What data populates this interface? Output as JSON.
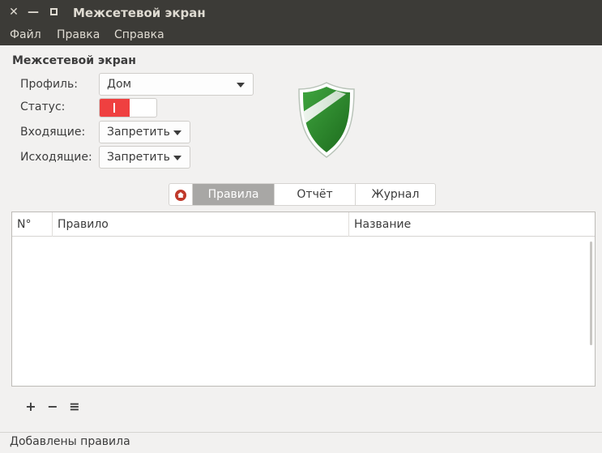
{
  "window": {
    "title": "Межсетевой экран",
    "close_glyph": "✕",
    "minimize_glyph": "—"
  },
  "menu": {
    "file": "Файл",
    "edit": "Правка",
    "help": "Справка"
  },
  "section": {
    "title": "Межсетевой экран"
  },
  "form": {
    "profile_label": "Профиль:",
    "profile_value": "Дом",
    "status_label": "Статус:",
    "status_on": true,
    "incoming_label": "Входящие:",
    "incoming_value": "Запретить",
    "outgoing_label": "Исходящие:",
    "outgoing_value": "Запретить"
  },
  "tabs": {
    "home_icon": "home-icon",
    "rules": "Правила",
    "report": "Отчёт",
    "log": "Журнал",
    "active": "rules"
  },
  "table": {
    "columns": [
      "N°",
      "Правило",
      "Название"
    ],
    "rows": []
  },
  "toolbar": {
    "add": "+",
    "remove": "−",
    "menu": "≡"
  },
  "status": {
    "text": "Добавлены правила"
  },
  "colors": {
    "titlebar": "#3c3b37",
    "switch_on": "#ef4040",
    "shield_green": "#2e8b2e",
    "active_tab": "#a8a7a5"
  }
}
